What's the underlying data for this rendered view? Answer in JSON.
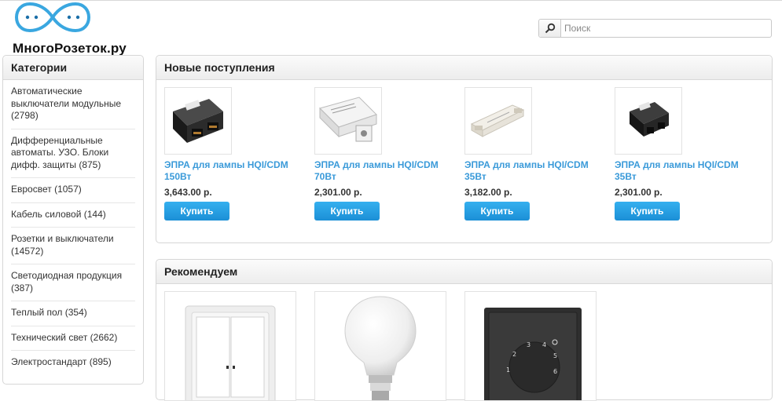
{
  "header": {
    "logo_text": "МногоРозеток.ру",
    "search_placeholder": "Поиск"
  },
  "sidebar": {
    "title": "Категории",
    "items": [
      {
        "label": "Автоматические выключатели модульные (2798)"
      },
      {
        "label": "Дифференциальные автоматы. УЗО. Блоки дифф. защиты (875)"
      },
      {
        "label": "Евросвет (1057)"
      },
      {
        "label": "Кабель силовой (144)"
      },
      {
        "label": "Розетки и выключатели (14572)"
      },
      {
        "label": "Светодиодная продукция (387)"
      },
      {
        "label": "Теплый пол (354)"
      },
      {
        "label": "Технический свет (2662)"
      },
      {
        "label": "Электростандарт (895)"
      }
    ]
  },
  "new_arrivals": {
    "title": "Новые поступления",
    "buy_label": "Купить",
    "products": [
      {
        "name": "ЭПРА для лампы HQI/CDM 150Вт",
        "price": "3,643.00 р.",
        "image": "black-ballast"
      },
      {
        "name": "ЭПРА для лампы HQI/CDM 70Вт",
        "price": "2,301.00 р.",
        "image": "white-ballast"
      },
      {
        "name": "ЭПРА для лампы HQI/CDM 35Вт",
        "price": "3,182.00 р.",
        "image": "white-driver"
      },
      {
        "name": "ЭПРА для лампы HQI/CDM 35Вт",
        "price": "2,301.00 р.",
        "image": "black-compact-ballast"
      }
    ]
  },
  "recommended": {
    "title": "Рекомендуем",
    "items": [
      {
        "image": "double-switch"
      },
      {
        "image": "led-bulb"
      },
      {
        "image": "thermostat"
      }
    ]
  }
}
